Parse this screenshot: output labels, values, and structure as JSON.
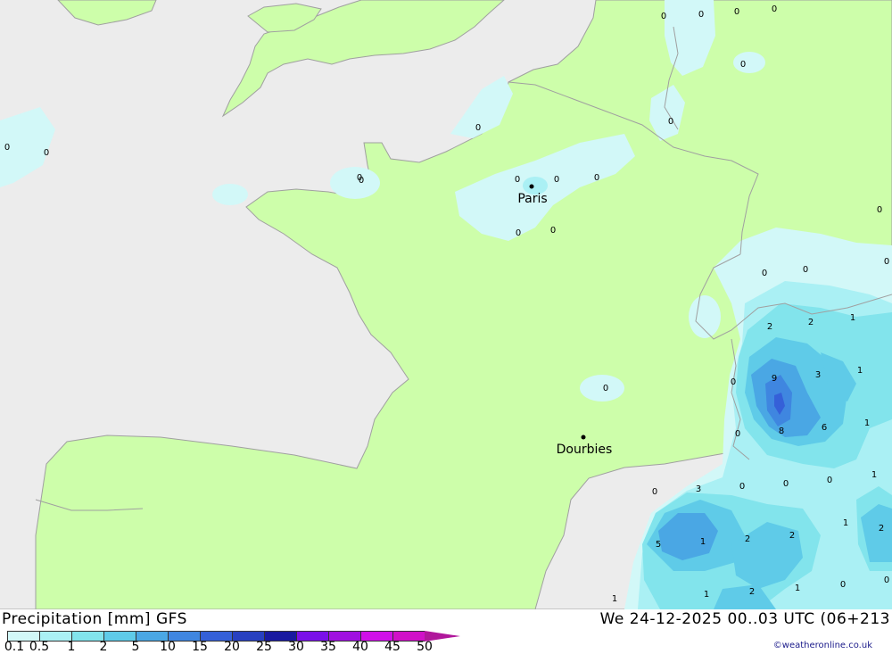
{
  "map": {
    "colors": {
      "sea": "#ececec",
      "land": "#cdfeaa",
      "border": "#a0a0a0",
      "p01": "#d2f8f8",
      "p05": "#aaf0f4",
      "p1": "#82e4ec",
      "p2": "#5fcbe8",
      "p5": "#4aa7e4",
      "p10": "#3f86e0",
      "p15": "#3560d8"
    },
    "cities": [
      {
        "name": "Paris"
      },
      {
        "name": "Dourbies"
      }
    ],
    "values": [
      "0",
      "0",
      "0",
      "0",
      "0",
      "0",
      "0",
      "0",
      "0",
      "0",
      "0",
      "0",
      "0",
      "0",
      "0",
      "0",
      "0",
      "0",
      "0",
      "0",
      "0",
      "0",
      "0",
      "0",
      "0",
      "2",
      "2",
      "1",
      "9",
      "3",
      "1",
      "6",
      "8",
      "1",
      "3",
      "1",
      "5",
      "1",
      "2",
      "2",
      "1",
      "1",
      "2",
      "1",
      "0",
      "0",
      "2",
      "1",
      "0",
      "0"
    ]
  },
  "legend": {
    "title": "Precipitation [mm] GFS",
    "datetime": "We 24-12-2025 00..03 UTC (06+213",
    "credit": "©weatheronline.co.uk",
    "scale": [
      {
        "label": "0.1",
        "color": "#d2f8f8"
      },
      {
        "label": "0.5",
        "color": "#aaf0f4"
      },
      {
        "label": "1",
        "color": "#82e4ec"
      },
      {
        "label": "2",
        "color": "#5fcbe8"
      },
      {
        "label": "5",
        "color": "#4aa7e4"
      },
      {
        "label": "10",
        "color": "#3f86e0"
      },
      {
        "label": "15",
        "color": "#3560d8"
      },
      {
        "label": "20",
        "color": "#2840c0"
      },
      {
        "label": "25",
        "color": "#1a1aa0"
      },
      {
        "label": "30",
        "color": "#7a10e8"
      },
      {
        "label": "35",
        "color": "#a010e0"
      },
      {
        "label": "40",
        "color": "#d010e8"
      },
      {
        "label": "45",
        "color": "#d010c8"
      },
      {
        "label": "50",
        "color": "#b0179b"
      }
    ]
  }
}
